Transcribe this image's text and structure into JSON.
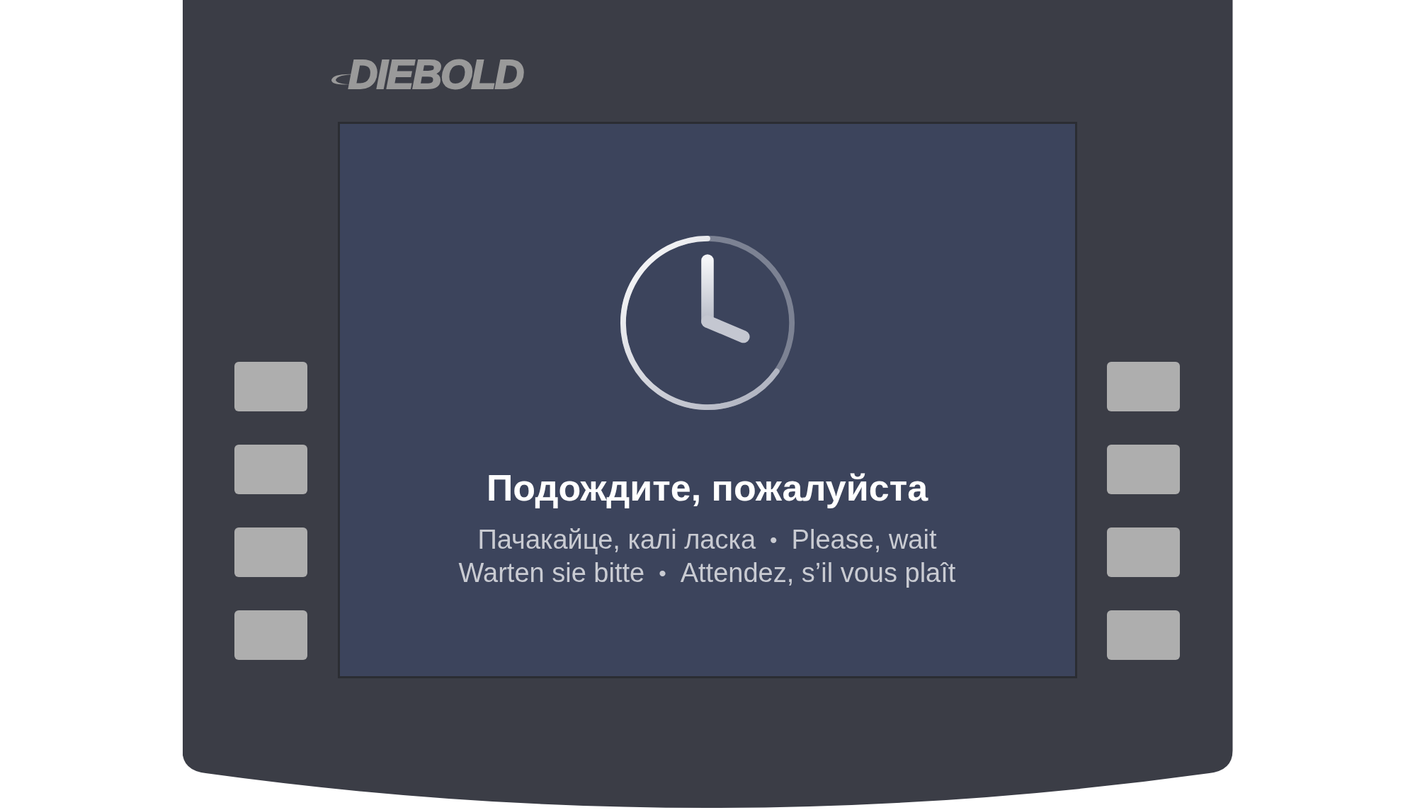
{
  "logo": {
    "text": "DIEBOLD"
  },
  "left_keys": [
    {
      "kind": "blank"
    },
    {
      "kind": "blank"
    },
    {
      "kind": "blank"
    },
    {
      "kind": "blank"
    }
  ],
  "right_keys": [
    {
      "kind": "blank"
    },
    {
      "kind": "blank"
    },
    {
      "kind": "blank"
    },
    {
      "kind": "blank"
    }
  ],
  "screen": {
    "title": "Подождите, пожалуйста",
    "lines": [
      {
        "left": "Пачакайце, калі ласка",
        "separator": "•",
        "right": "Please, wait"
      },
      {
        "left": "Warten sie bitte",
        "separator": "•",
        "right": "Attendez, s’il vous plaît"
      }
    ]
  }
}
